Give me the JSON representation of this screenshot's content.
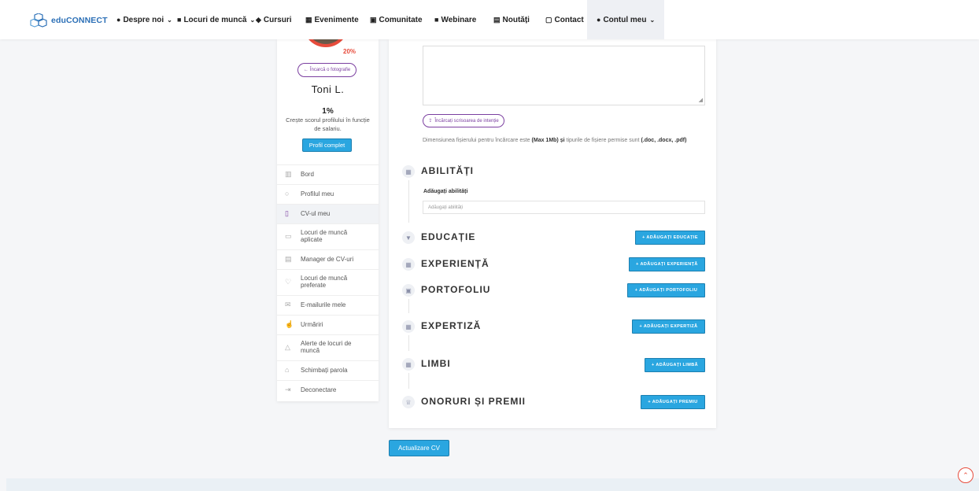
{
  "logo": {
    "text": "eduCONNECT"
  },
  "nav": {
    "despre": "Despre noi",
    "locuri": "Locuri de muncă",
    "cursuri": "Cursuri",
    "evenimente": "Evenimente",
    "comunitate": "Comunitate",
    "webinare": "Webinare",
    "noutati": "Noutăți",
    "contact": "Contact",
    "cont": "Contul meu"
  },
  "sidebar": {
    "avatar_percent": "20%",
    "upload_photo": "Încarcă o fotografie",
    "user_name": "Toni L.",
    "score_percent": "1%",
    "score_desc": "Crește scorul profilului în funcție de salariu.",
    "profile_button": "Profil complet",
    "menu": [
      {
        "label": "Bord"
      },
      {
        "label": "Profilul meu"
      },
      {
        "label": "CV-ul meu"
      },
      {
        "label": "Locuri de muncă aplicate"
      },
      {
        "label": "Manager de CV-uri"
      },
      {
        "label": "Locuri de muncă preferate"
      },
      {
        "label": "E-mailurile mele"
      },
      {
        "label": "Urmăriri"
      },
      {
        "label": "Alerte de locuri de muncă"
      },
      {
        "label": "Schimbați parola"
      },
      {
        "label": "Deconectare"
      }
    ]
  },
  "main": {
    "upload_cover": "Încărcați scrisoarea de intenție",
    "file_note_prefix": "Dimensiunea fișierului pentru încărcare este",
    "file_note_max": "(Max 1Mb)",
    "file_note_and": "și",
    "file_note_mid": "tipurile de fișiere permise sunt",
    "file_note_types": "(.doc, .docx, .pdf)",
    "skills": {
      "title": "ABILITĂȚI",
      "label": "Adăugați abilități",
      "placeholder": "Adăugați abilități"
    },
    "education": {
      "title": "EDUCAȚIE",
      "button": "+ ADĂUGAȚI EDUCAȚIE"
    },
    "experience": {
      "title": "EXPERIENȚĂ",
      "button": "+ ADĂUGAȚI EXPERIENȚĂ"
    },
    "portfolio": {
      "title": "PORTOFOLIU",
      "button": "+ ADĂUGAȚI PORTOFOLIU"
    },
    "expertise": {
      "title": "EXPERTIZĂ",
      "button": "+ ADĂUGAȚI EXPERTIZĂ"
    },
    "languages": {
      "title": "LIMBI",
      "button": "+ ADĂUGAȚI LIMBĂ"
    },
    "awards": {
      "title": "ONORURI ȘI PREMII",
      "button": "+ ADĂUGAȚI PREMIU"
    }
  },
  "update_button": "Actualizare CV"
}
